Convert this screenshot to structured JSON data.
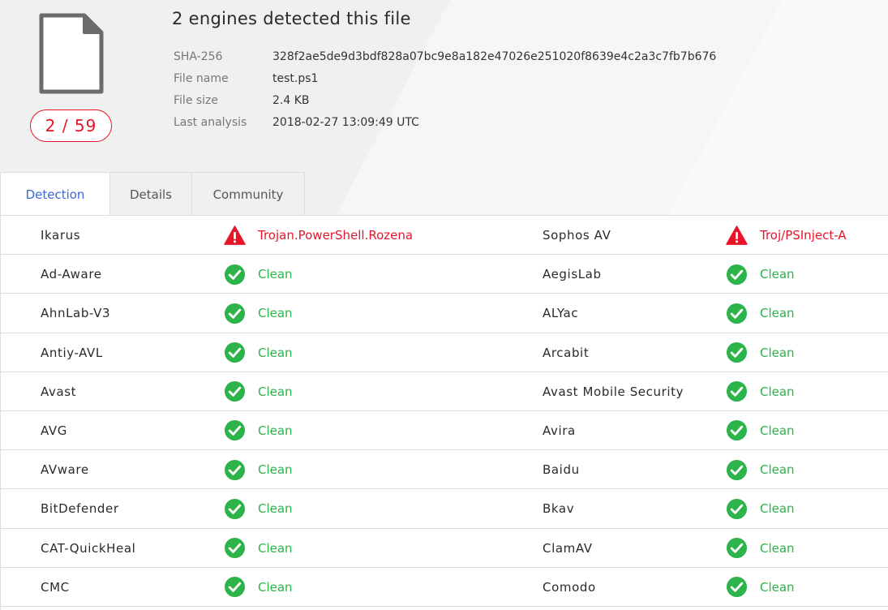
{
  "colors": {
    "detected": "#e8142a",
    "clean": "#2cb34a",
    "active_tab": "#3a66d8"
  },
  "header": {
    "title": "2 engines detected this file",
    "score": "2 / 59",
    "file_icon": "document-icon",
    "meta": [
      {
        "label": "SHA-256",
        "value": "328f2ae5de9d3bdf828a07bc9e8a182e47026e251020f8639e4c2a3c7fb7b676"
      },
      {
        "label": "File name",
        "value": "test.ps1"
      },
      {
        "label": "File size",
        "value": "2.4 KB"
      },
      {
        "label": "Last analysis",
        "value": "2018-02-27 13:09:49 UTC"
      }
    ]
  },
  "tabs": [
    {
      "label": "Detection",
      "active": true
    },
    {
      "label": "Details",
      "active": false
    },
    {
      "label": "Community",
      "active": false
    }
  ],
  "results": [
    {
      "left": {
        "engine": "Ikarus",
        "result": "Trojan.PowerShell.Rozena",
        "status": "detected",
        "icon": "alert-triangle-icon"
      },
      "right": {
        "engine": "Sophos AV",
        "result": "Troj/PSInject-A",
        "status": "detected",
        "icon": "alert-triangle-icon"
      }
    },
    {
      "left": {
        "engine": "Ad-Aware",
        "result": "Clean",
        "status": "clean",
        "icon": "check-circle-icon"
      },
      "right": {
        "engine": "AegisLab",
        "result": "Clean",
        "status": "clean",
        "icon": "check-circle-icon"
      }
    },
    {
      "left": {
        "engine": "AhnLab-V3",
        "result": "Clean",
        "status": "clean",
        "icon": "check-circle-icon"
      },
      "right": {
        "engine": "ALYac",
        "result": "Clean",
        "status": "clean",
        "icon": "check-circle-icon"
      }
    },
    {
      "left": {
        "engine": "Antiy-AVL",
        "result": "Clean",
        "status": "clean",
        "icon": "check-circle-icon"
      },
      "right": {
        "engine": "Arcabit",
        "result": "Clean",
        "status": "clean",
        "icon": "check-circle-icon"
      }
    },
    {
      "left": {
        "engine": "Avast",
        "result": "Clean",
        "status": "clean",
        "icon": "check-circle-icon"
      },
      "right": {
        "engine": "Avast Mobile Security",
        "result": "Clean",
        "status": "clean",
        "icon": "check-circle-icon"
      }
    },
    {
      "left": {
        "engine": "AVG",
        "result": "Clean",
        "status": "clean",
        "icon": "check-circle-icon"
      },
      "right": {
        "engine": "Avira",
        "result": "Clean",
        "status": "clean",
        "icon": "check-circle-icon"
      }
    },
    {
      "left": {
        "engine": "AVware",
        "result": "Clean",
        "status": "clean",
        "icon": "check-circle-icon"
      },
      "right": {
        "engine": "Baidu",
        "result": "Clean",
        "status": "clean",
        "icon": "check-circle-icon"
      }
    },
    {
      "left": {
        "engine": "BitDefender",
        "result": "Clean",
        "status": "clean",
        "icon": "check-circle-icon"
      },
      "right": {
        "engine": "Bkav",
        "result": "Clean",
        "status": "clean",
        "icon": "check-circle-icon"
      }
    },
    {
      "left": {
        "engine": "CAT-QuickHeal",
        "result": "Clean",
        "status": "clean",
        "icon": "check-circle-icon"
      },
      "right": {
        "engine": "ClamAV",
        "result": "Clean",
        "status": "clean",
        "icon": "check-circle-icon"
      }
    },
    {
      "left": {
        "engine": "CMC",
        "result": "Clean",
        "status": "clean",
        "icon": "check-circle-icon"
      },
      "right": {
        "engine": "Comodo",
        "result": "Clean",
        "status": "clean",
        "icon": "check-circle-icon"
      }
    }
  ]
}
